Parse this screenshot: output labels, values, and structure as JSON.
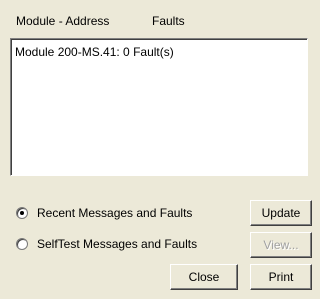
{
  "header": {
    "module_address_label": "Module - Address",
    "faults_label": "Faults"
  },
  "list": {
    "rows": [
      "Module 200-MS.41:  0 Fault(s)"
    ]
  },
  "options": {
    "recent": {
      "label": "Recent Messages and Faults",
      "selected": true
    },
    "selftest": {
      "label": "SelfTest Messages and Faults",
      "selected": false
    }
  },
  "buttons": {
    "update": "Update",
    "view": "View...",
    "close": "Close",
    "print": "Print"
  }
}
